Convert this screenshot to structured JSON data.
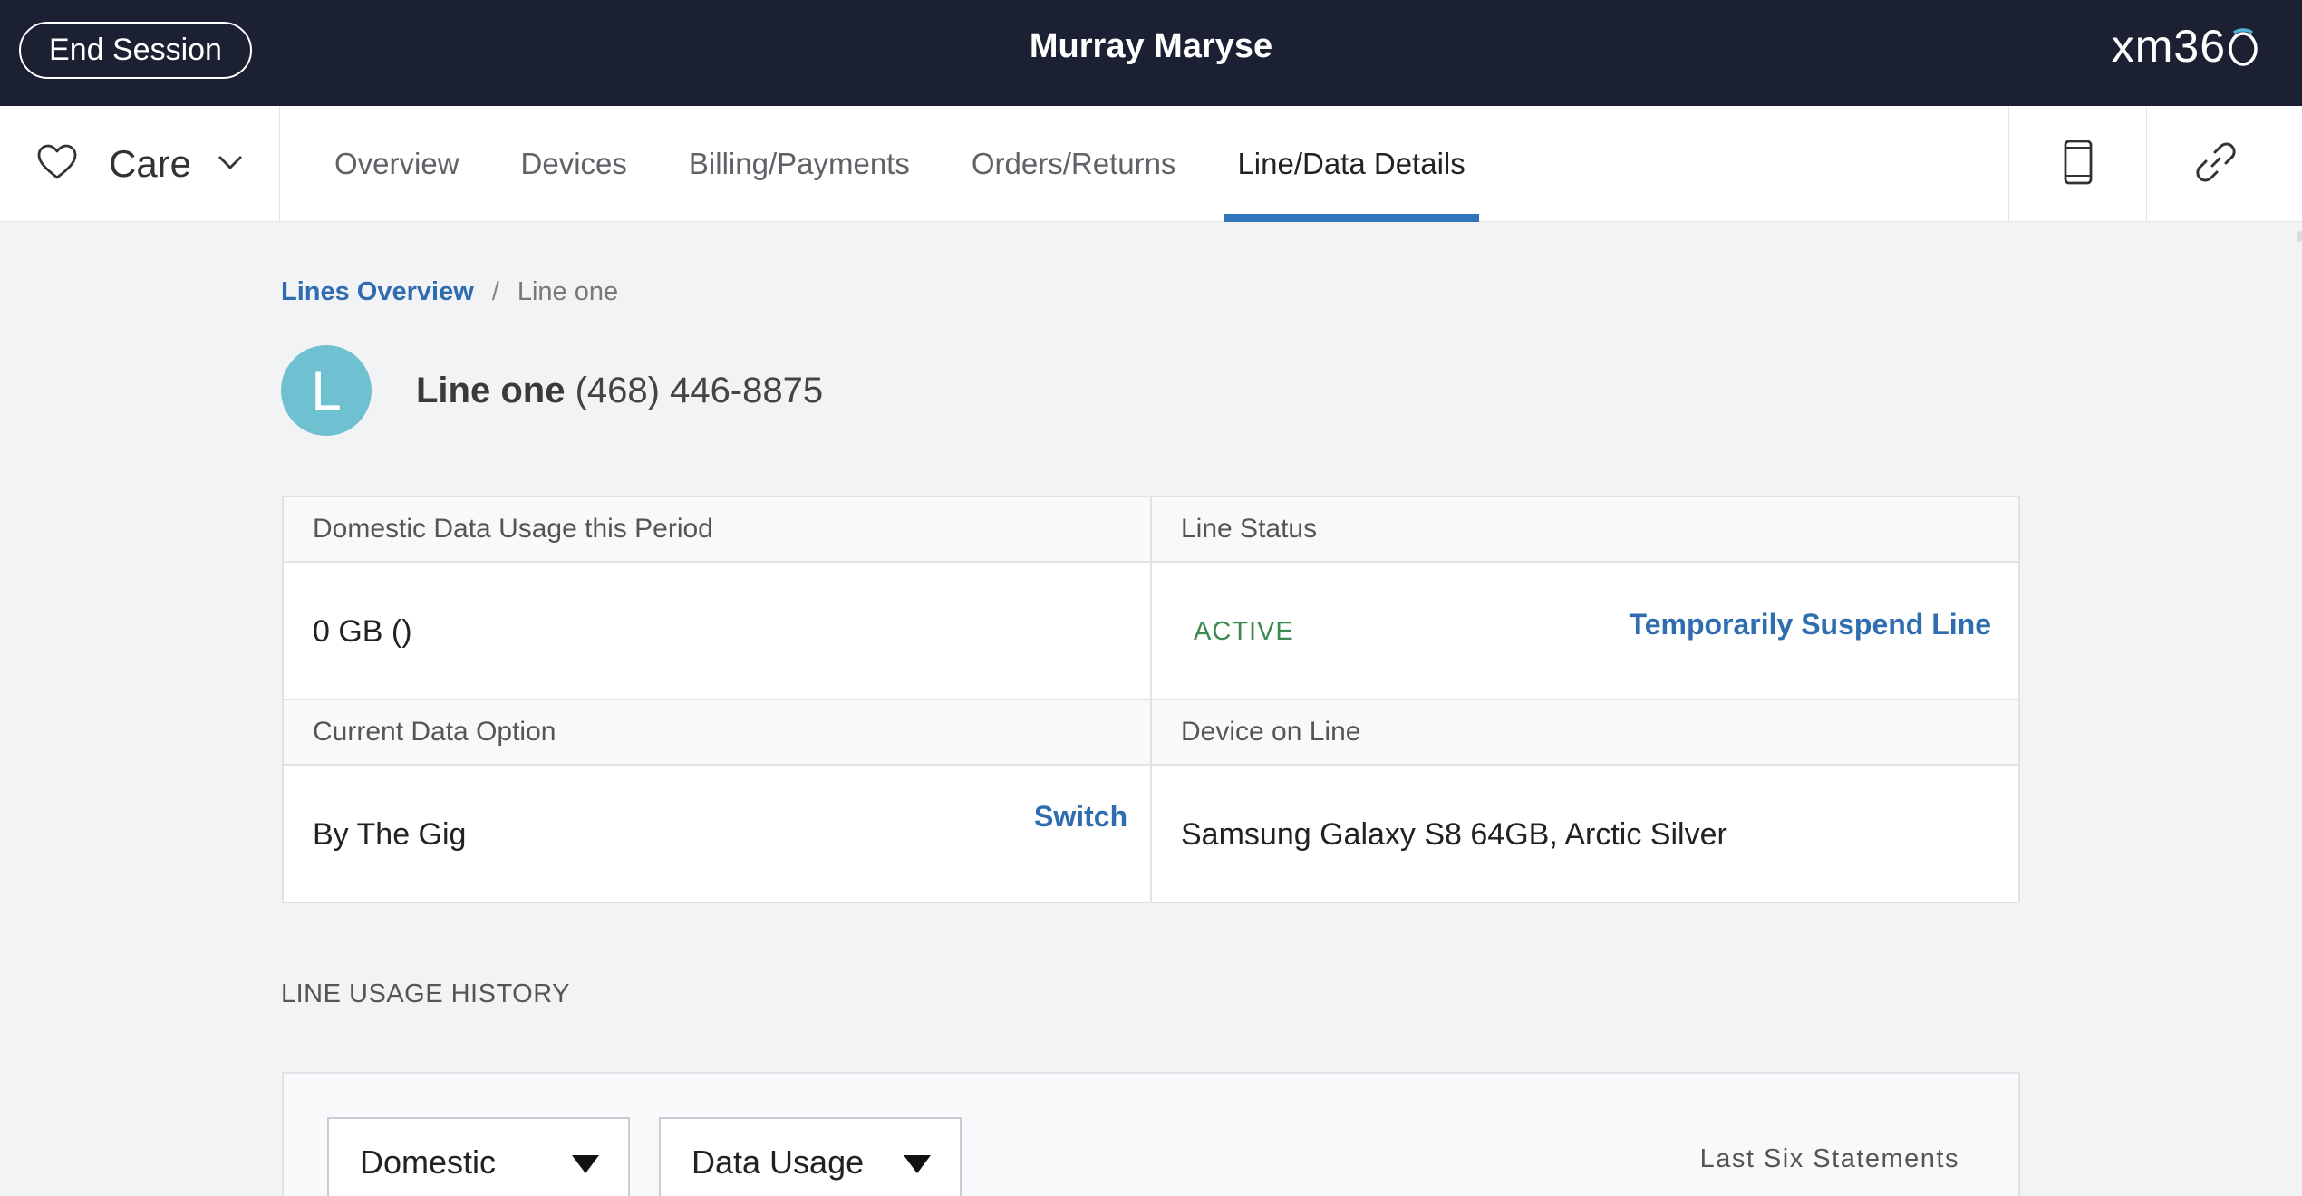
{
  "topbar": {
    "end_session_label": "End Session",
    "customer_name": "Murray Maryse",
    "brand_text": "xm36",
    "brand_icon": "power-o-icon"
  },
  "nav": {
    "care_label": "Care",
    "care_icon": "heart-icon",
    "tabs": [
      {
        "label": "Overview"
      },
      {
        "label": "Devices"
      },
      {
        "label": "Billing/Payments"
      },
      {
        "label": "Orders/Returns"
      },
      {
        "label": "Line/Data Details",
        "active": true
      }
    ],
    "active_tab_color": "#2f75bb",
    "right_icons": [
      "phone-icon",
      "link-icon"
    ]
  },
  "breadcrumb": {
    "parent": "Lines Overview",
    "separator": "/",
    "current": "Line one"
  },
  "line": {
    "avatar_letter": "L",
    "name": "Line one",
    "phone": "(468) 446-8875"
  },
  "info": {
    "data_usage": {
      "label": "Domestic Data Usage this Period",
      "value": "0 GB ()"
    },
    "line_status": {
      "label": "Line Status",
      "value": "ACTIVE",
      "action": "Temporarily Suspend Line"
    },
    "data_option": {
      "label": "Current Data Option",
      "value": "By The Gig",
      "action": "Switch"
    },
    "device": {
      "label": "Device on Line",
      "value": "Samsung Galaxy S8 64GB, Arctic Silver"
    }
  },
  "usage_history": {
    "title": "LINE USAGE HISTORY",
    "region_select": "Domestic",
    "type_select": "Data Usage",
    "period_label": "Last Six Statements"
  },
  "colors": {
    "topbar_bg": "#1b2132",
    "link": "#2f6db0",
    "status_active": "#3c8a4f",
    "avatar_bg": "#6fc0d1"
  }
}
